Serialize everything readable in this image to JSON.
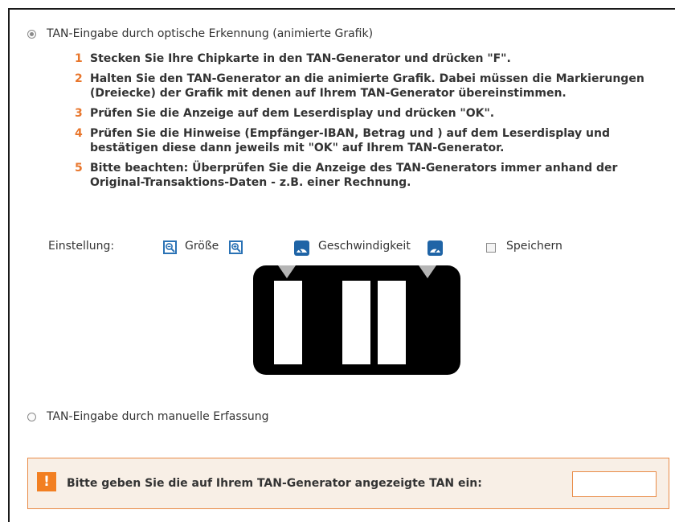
{
  "option_optical": {
    "label": "TAN-Eingabe durch optische Erkennung (animierte Grafik)",
    "selected": true
  },
  "steps": [
    {
      "num": "1",
      "text": "Stecken Sie Ihre Chipkarte in den TAN-Generator und drücken \"F\"."
    },
    {
      "num": "2",
      "text": "Halten Sie den TAN-Generator an die animierte Grafik. Dabei müssen die Markierungen (Dreiecke) der Grafik mit denen auf Ihrem TAN-Generator übereinstimmen."
    },
    {
      "num": "3",
      "text": "Prüfen Sie die Anzeige auf dem Leserdisplay und drücken \"OK\"."
    },
    {
      "num": "4",
      "text": "Prüfen Sie die Hinweise (Empfänger-IBAN, Betrag und ) auf dem Leserdisplay und bestätigen diese dann jeweils mit \"OK\" auf Ihrem TAN-Generator."
    },
    {
      "num": "5",
      "text": "Bitte beachten: Überprüfen Sie die Anzeige des TAN-Generators immer anhand der Original-Transaktions-Daten - z.B. einer Rechnung."
    }
  ],
  "settings": {
    "label": "Einstellung:",
    "size_label": "Größe",
    "speed_label": "Geschwindigkeit",
    "save_label": "Speichern",
    "save_checked": false
  },
  "option_manual": {
    "label": "TAN-Eingabe durch manuelle Erfassung",
    "selected": false
  },
  "tan_prompt": {
    "icon": "!",
    "label": "Bitte geben Sie die auf Ihrem TAN-Generator angezeigte TAN ein:",
    "value": ""
  },
  "colors": {
    "accent_orange": "#e8762c",
    "icon_blue": "#2a72b5",
    "prompt_background": "#f8efe6"
  }
}
